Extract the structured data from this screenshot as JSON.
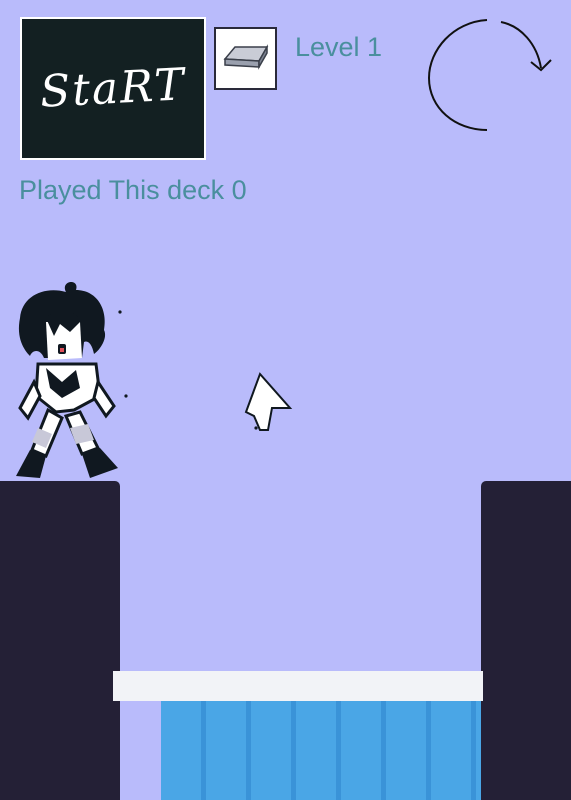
{
  "hud": {
    "start_label": "StaRT",
    "level_text": "Level 1",
    "played_text": "Played This deck 0",
    "deck_icon": "card-deck-icon",
    "restart_icon": "circular-arrow-icon"
  },
  "colors": {
    "background": "#b9bbfb",
    "hud_text": "#4a8f9e",
    "pillar": "#242036",
    "water": "#4aa6e6",
    "platform": "#f2f3f7"
  }
}
